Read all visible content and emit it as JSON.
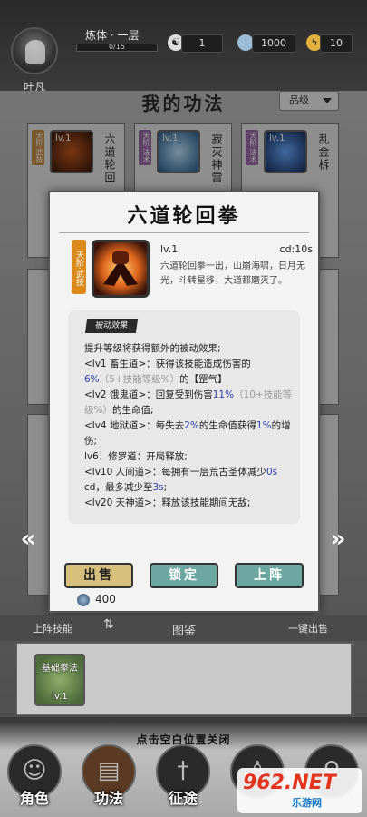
{
  "player": {
    "name": "叶凡",
    "realm": "炼体 · 一层",
    "exp": "0/15"
  },
  "stats": [
    {
      "icon": "yin-yang-icon",
      "value": "1"
    },
    {
      "icon": "spirit-stone-icon",
      "value": "1000"
    },
    {
      "icon": "lightning-icon",
      "value": "10"
    }
  ],
  "section": {
    "title": "我的功法",
    "sort_label": "品级"
  },
  "cards": [
    {
      "tier": "天阶·武技",
      "level": "lv.1",
      "name": "六道轮回"
    },
    {
      "tier": "天阶·法术",
      "level": "lv.1",
      "name": "寂灭神雷"
    },
    {
      "tier": "天阶·法术",
      "level": "lv.1",
      "name": "乱金柝"
    }
  ],
  "modal": {
    "title": "六道轮回拳",
    "tier": "天阶·武技",
    "level": "lv.1",
    "cd": "cd:10s",
    "description": "六道轮回拳一出，山崩海啸，日月无光，斗转星移，大道都磨灭了。",
    "passive_label": "被动效果",
    "passive_lines": [
      [
        {
          "t": "提升等级将获得额外的被动效果;",
          "c": ""
        }
      ],
      [
        {
          "t": "<lv1 畜生道>：获得该技能造成伤害的",
          "c": ""
        },
        {
          "t": "6%",
          "c": "hl"
        },
        {
          "t": "（5+技能等级%）",
          "c": "gray"
        },
        {
          "t": "的【罡气】",
          "c": ""
        }
      ],
      [
        {
          "t": "<lv2 饿鬼道>：回复受到伤害",
          "c": ""
        },
        {
          "t": "11%",
          "c": "hl"
        },
        {
          "t": "（10+技能等级%）",
          "c": "gray"
        },
        {
          "t": "的生命值;",
          "c": ""
        }
      ],
      [
        {
          "t": "<lv4 地狱道>：每失去",
          "c": ""
        },
        {
          "t": "2%",
          "c": "hl"
        },
        {
          "t": "的生命值获得",
          "c": ""
        },
        {
          "t": "1%",
          "c": "hl"
        },
        {
          "t": "的增伤;",
          "c": ""
        }
      ],
      [
        {
          "t": "lv6：修罗道：开局释放;",
          "c": ""
        }
      ],
      [
        {
          "t": "<lv10 人间道>：每拥有一层荒古圣体减少",
          "c": ""
        },
        {
          "t": "0s",
          "c": "hl"
        },
        {
          "t": " cd，最多减少至",
          "c": ""
        },
        {
          "t": "3s",
          "c": "hl"
        },
        {
          "t": ";",
          "c": ""
        }
      ],
      [
        {
          "t": "<lv20 天神道>：释放该技能期间无敌;",
          "c": ""
        }
      ]
    ],
    "buttons": {
      "sell": "出售",
      "lock": "锁定",
      "equip": "上阵"
    },
    "price": "400"
  },
  "lower": {
    "equipped_label": "上阵技能",
    "atlas_label": "图鉴",
    "sell_all_label": "一键出售",
    "slot": {
      "name": "基础拳法",
      "level": "lv.1"
    },
    "hint": "点击空白位置关闭"
  },
  "nav": [
    {
      "label": "角色",
      "icon": "character-icon"
    },
    {
      "label": "功法",
      "icon": "scroll-icon"
    },
    {
      "label": "征途",
      "icon": "sword-icon"
    },
    {
      "label": "",
      "icon": "figure-icon"
    },
    {
      "label": "",
      "icon": "girl-icon"
    }
  ],
  "watermark": {
    "main": "962.NET",
    "sub": "乐游网"
  },
  "colors": {
    "accent_teal": "#6da7a2",
    "sell_gold": "#d7c07c",
    "tier_orange": "#d98a1a",
    "highlight_blue": "#2b3fa8"
  }
}
